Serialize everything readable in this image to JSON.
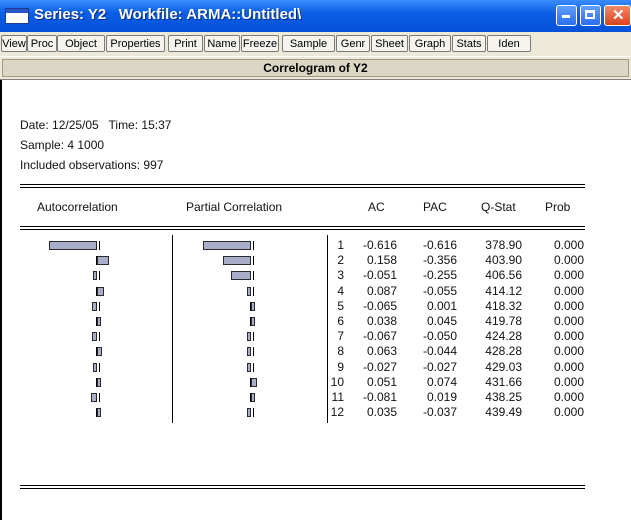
{
  "window": {
    "title": "Series: Y2   Workfile: ARMA::Untitled\\"
  },
  "toolbar": {
    "buttons": [
      "View",
      "Proc",
      "Object",
      "Properties",
      "Print",
      "Name",
      "Freeze",
      "Sample",
      "Genr",
      "Sheet",
      "Graph",
      "Stats",
      "Iden"
    ]
  },
  "view": {
    "title": "Correlogram of Y2"
  },
  "info": {
    "date_line": "Date: 12/25/05   Time: 15:37",
    "sample_line": "Sample: 4 1000",
    "obs_line": "Included observations: 997"
  },
  "table": {
    "headers": {
      "autocorrelation": "Autocorrelation",
      "partial": "Partial Correlation",
      "ac": "AC",
      "pac": "PAC",
      "qstat": "Q-Stat",
      "prob": "Prob"
    },
    "rows": [
      {
        "lag": "1",
        "ac": "-0.616",
        "pac": "-0.616",
        "q": "378.90",
        "p": "0.000"
      },
      {
        "lag": "2",
        "ac": "0.158",
        "pac": "-0.356",
        "q": "403.90",
        "p": "0.000"
      },
      {
        "lag": "3",
        "ac": "-0.051",
        "pac": "-0.255",
        "q": "406.56",
        "p": "0.000"
      },
      {
        "lag": "4",
        "ac": "0.087",
        "pac": "-0.055",
        "q": "414.12",
        "p": "0.000"
      },
      {
        "lag": "5",
        "ac": "-0.065",
        "pac": "0.001",
        "q": "418.32",
        "p": "0.000"
      },
      {
        "lag": "6",
        "ac": "0.038",
        "pac": "0.045",
        "q": "419.78",
        "p": "0.000"
      },
      {
        "lag": "7",
        "ac": "-0.067",
        "pac": "-0.050",
        "q": "424.28",
        "p": "0.000"
      },
      {
        "lag": "8",
        "ac": "0.063",
        "pac": "-0.044",
        "q": "428.28",
        "p": "0.000"
      },
      {
        "lag": "9",
        "ac": "-0.027",
        "pac": "-0.027",
        "q": "429.03",
        "p": "0.000"
      },
      {
        "lag": "10",
        "ac": "0.051",
        "pac": "0.074",
        "q": "431.66",
        "p": "0.000"
      },
      {
        "lag": "11",
        "ac": "-0.081",
        "pac": "0.019",
        "q": "438.25",
        "p": "0.000"
      },
      {
        "lag": "12",
        "ac": "0.035",
        "pac": "-0.037",
        "q": "439.49",
        "p": "0.000"
      }
    ]
  },
  "colors": {
    "bar_fill": "#a8aeca",
    "titlebar": "#0a5fe6"
  }
}
